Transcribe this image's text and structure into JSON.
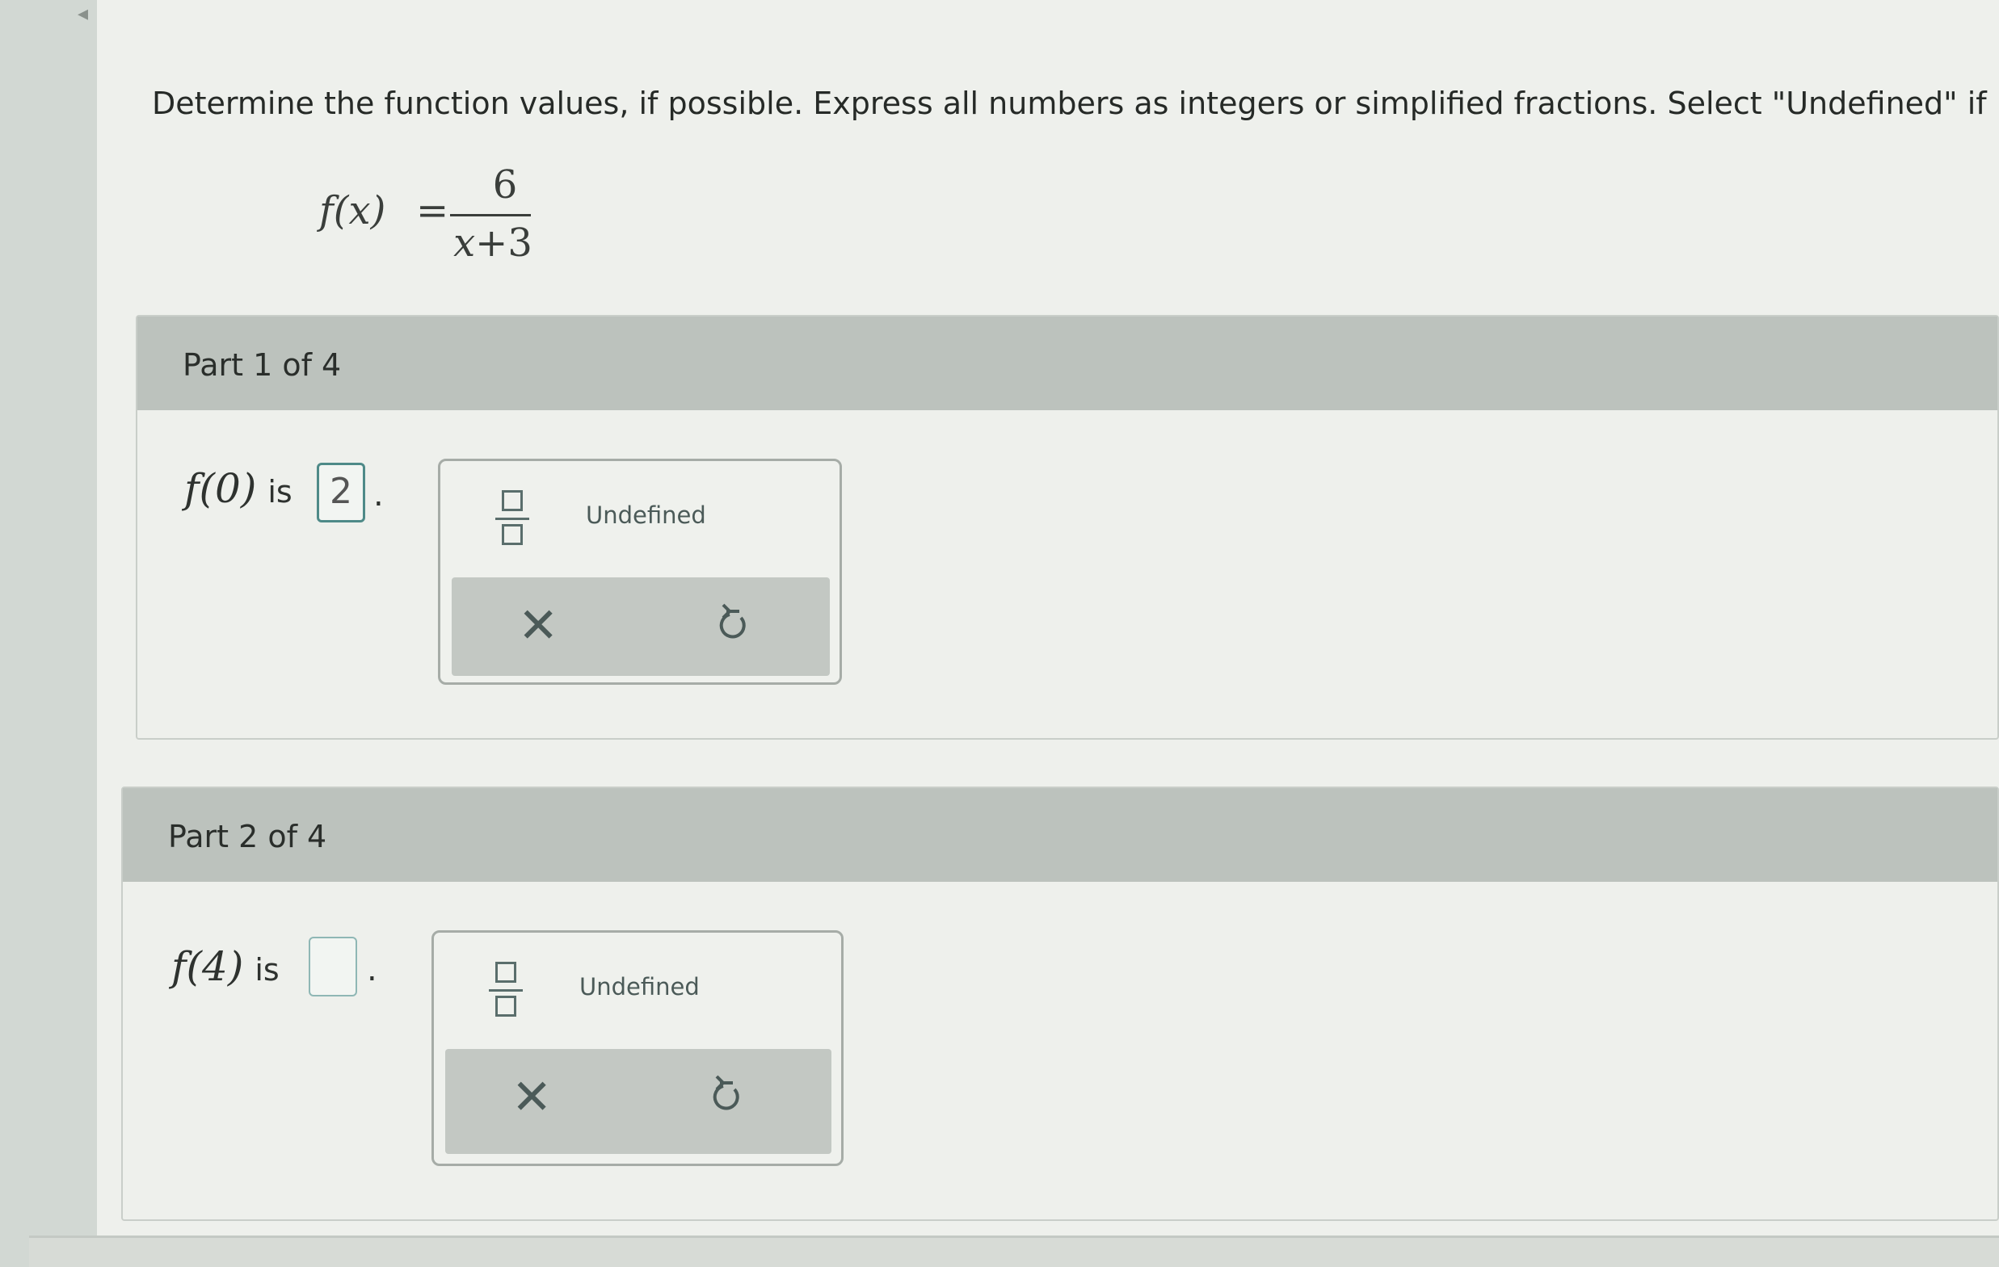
{
  "instructions": "Determine the function values, if possible. Express all numbers as integers or simplified fractions. Select \"Undefined\" if",
  "function": {
    "lhs": "f(x)",
    "equals": "=",
    "numerator": "6",
    "denominator_var": "x",
    "denominator_rest": "+3"
  },
  "parts": [
    {
      "title": "Part 1 of 4",
      "prompt_fn": "f(0)",
      "prompt_is": "is",
      "answer": "2",
      "period": ".",
      "undefined_label": "Undefined"
    },
    {
      "title": "Part 2 of 4",
      "prompt_fn": "f(4)",
      "prompt_is": "is",
      "answer": "",
      "period": ".",
      "undefined_label": "Undefined"
    }
  ],
  "icons": {
    "fraction": "fraction-template-icon",
    "clear": "clear-x-icon",
    "undo": "undo-icon"
  },
  "colors": {
    "header_bg": "#bcc2bd",
    "answer_border": "#4e8a88",
    "icon": "#4b5a58"
  }
}
